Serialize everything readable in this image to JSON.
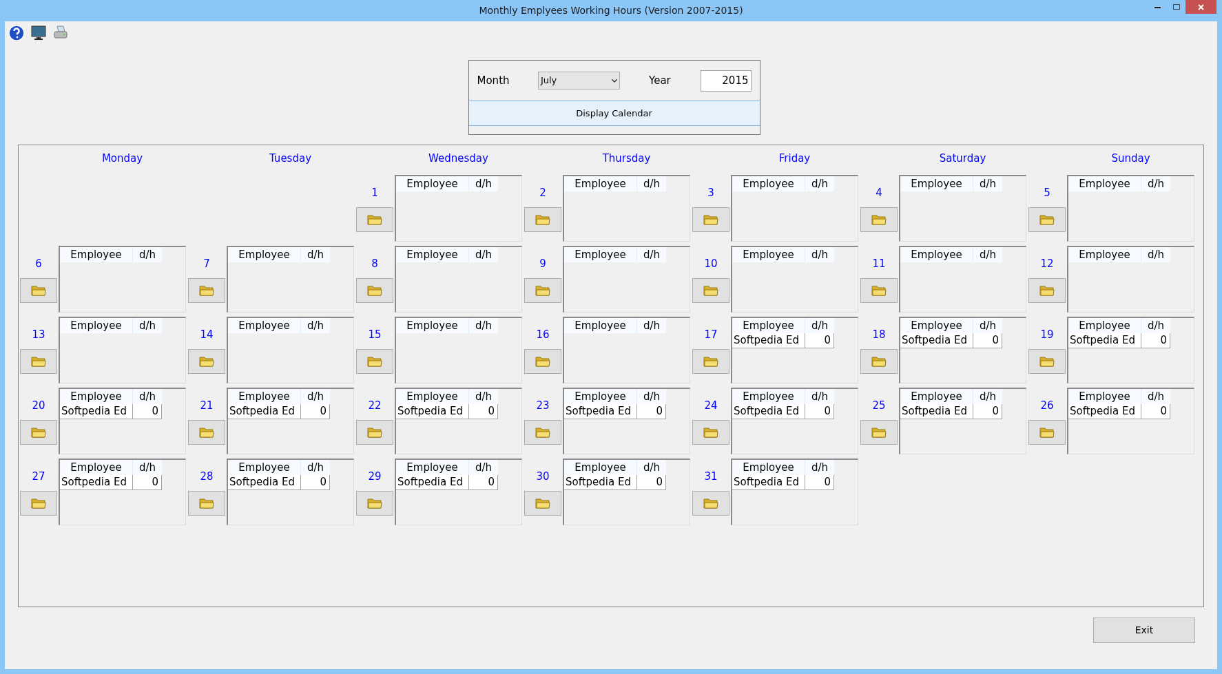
{
  "window": {
    "title": "Monthly Emplyees Working Hours (Version 2007-2015)"
  },
  "form": {
    "month_label": "Month",
    "month_value": "July",
    "year_label": "Year",
    "year_value": "2015",
    "display_button": "Display Calendar"
  },
  "calendar": {
    "weekdays": [
      "Monday",
      "Tuesday",
      "Wednesday",
      "Thursday",
      "Friday",
      "Saturday",
      "Sunday"
    ],
    "weeks": [
      [
        {
          "kind": "blank"
        },
        {
          "kind": "blank"
        },
        {
          "day": "1",
          "columns": [
            "Employee",
            "d/h"
          ]
        },
        {
          "day": "2",
          "columns": [
            "Employee",
            "d/h"
          ]
        },
        {
          "day": "3",
          "columns": [
            "Employee",
            "d/h"
          ]
        },
        {
          "day": "4",
          "columns": [
            "Employee",
            "d/h"
          ]
        },
        {
          "day": "5",
          "columns": [
            "Employee",
            "d/h"
          ]
        }
      ],
      [
        {
          "day": "6",
          "columns": [
            "Employee",
            "d/h"
          ]
        },
        {
          "day": "7",
          "columns": [
            "Employee",
            "d/h"
          ]
        },
        {
          "day": "8",
          "columns": [
            "Employee",
            "d/h"
          ]
        },
        {
          "day": "9",
          "columns": [
            "Employee",
            "d/h"
          ]
        },
        {
          "day": "10",
          "columns": [
            "Employee",
            "d/h"
          ]
        },
        {
          "day": "11",
          "columns": [
            "Employee",
            "d/h"
          ]
        },
        {
          "day": "12",
          "columns": [
            "Employee",
            "d/h"
          ]
        }
      ],
      [
        {
          "day": "13",
          "columns": [
            "Employee",
            "d/h"
          ]
        },
        {
          "day": "14",
          "columns": [
            "Employee",
            "d/h"
          ]
        },
        {
          "day": "15",
          "columns": [
            "Employee",
            "d/h"
          ]
        },
        {
          "day": "16",
          "columns": [
            "Employee",
            "d/h"
          ]
        },
        {
          "day": "17",
          "columns": [
            "Employee",
            "d/h"
          ],
          "rows": [
            {
              "employee": "Softpedia Ed",
              "hours": "0"
            }
          ]
        },
        {
          "day": "18",
          "columns": [
            "Employee",
            "d/h"
          ],
          "rows": [
            {
              "employee": "Softpedia Ed",
              "hours": "0"
            }
          ]
        },
        {
          "day": "19",
          "columns": [
            "Employee",
            "d/h"
          ],
          "rows": [
            {
              "employee": "Softpedia Ed",
              "hours": "0"
            }
          ]
        }
      ],
      [
        {
          "day": "20",
          "columns": [
            "Employee",
            "d/h"
          ],
          "rows": [
            {
              "employee": "Softpedia Ed",
              "hours": "0"
            }
          ]
        },
        {
          "day": "21",
          "columns": [
            "Employee",
            "d/h"
          ],
          "rows": [
            {
              "employee": "Softpedia Ed",
              "hours": "0"
            }
          ]
        },
        {
          "day": "22",
          "columns": [
            "Employee",
            "d/h"
          ],
          "rows": [
            {
              "employee": "Softpedia Ed",
              "hours": "0"
            }
          ]
        },
        {
          "day": "23",
          "columns": [
            "Employee",
            "d/h"
          ],
          "rows": [
            {
              "employee": "Softpedia Ed",
              "hours": "0"
            }
          ]
        },
        {
          "day": "24",
          "columns": [
            "Employee",
            "d/h"
          ],
          "rows": [
            {
              "employee": "Softpedia Ed",
              "hours": "0"
            }
          ]
        },
        {
          "day": "25",
          "columns": [
            "Employee",
            "d/h"
          ],
          "rows": [
            {
              "employee": "Softpedia Ed",
              "hours": "0"
            }
          ]
        },
        {
          "day": "26",
          "columns": [
            "Employee",
            "d/h"
          ],
          "rows": [
            {
              "employee": "Softpedia Ed",
              "hours": "0"
            }
          ]
        }
      ],
      [
        {
          "day": "27",
          "columns": [
            "Employee",
            "d/h"
          ],
          "rows": [
            {
              "employee": "Softpedia Ed",
              "hours": "0"
            }
          ]
        },
        {
          "day": "28",
          "columns": [
            "Employee",
            "d/h"
          ],
          "rows": [
            {
              "employee": "Softpedia Ed",
              "hours": "0"
            }
          ]
        },
        {
          "day": "29",
          "columns": [
            "Employee",
            "d/h"
          ],
          "rows": [
            {
              "employee": "Softpedia Ed",
              "hours": "0"
            }
          ]
        },
        {
          "day": "30",
          "columns": [
            "Employee",
            "d/h"
          ],
          "rows": [
            {
              "employee": "Softpedia Ed",
              "hours": "0"
            }
          ]
        },
        {
          "day": "31",
          "columns": [
            "Employee",
            "d/h"
          ],
          "rows": [
            {
              "employee": "Softpedia Ed",
              "hours": "0"
            }
          ]
        },
        {
          "kind": "blank"
        },
        {
          "kind": "blank"
        }
      ]
    ]
  },
  "exit_button": "Exit"
}
